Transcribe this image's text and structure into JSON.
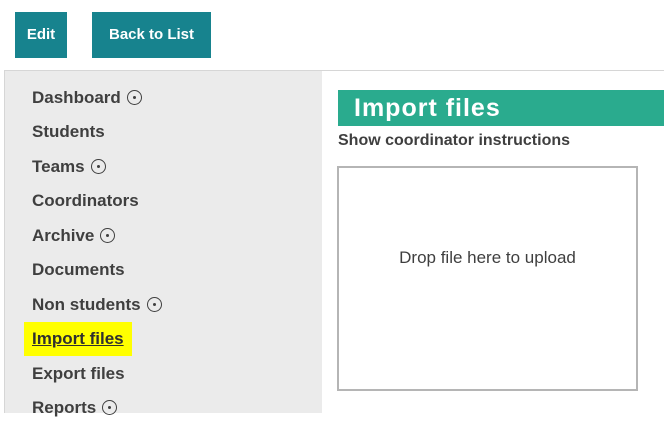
{
  "toolbar": {
    "edit_label": "Edit",
    "back_label": "Back to List"
  },
  "sidebar": {
    "items": [
      {
        "label": "Dashboard",
        "has_chevron": true
      },
      {
        "label": "Students",
        "has_chevron": false
      },
      {
        "label": "Teams",
        "has_chevron": true
      },
      {
        "label": "Coordinators",
        "has_chevron": false
      },
      {
        "label": "Archive",
        "has_chevron": true
      },
      {
        "label": "Documents",
        "has_chevron": false
      },
      {
        "label": "Non students",
        "has_chevron": true
      },
      {
        "label": "Import files",
        "has_chevron": false,
        "active": true
      },
      {
        "label": "Export files",
        "has_chevron": false
      },
      {
        "label": "Reports",
        "has_chevron": true
      }
    ]
  },
  "main": {
    "title": "Import files",
    "instructions_link": "Show coordinator instructions",
    "dropzone_text": "Drop file here to upload"
  },
  "colors": {
    "button_bg": "#17838e",
    "title_bg": "#2aab8e",
    "sidebar_bg": "#ebebeb",
    "highlight": "#ffff00",
    "text": "#3f3f3f"
  },
  "icons": {
    "expand": "chevron-circle-icon"
  }
}
